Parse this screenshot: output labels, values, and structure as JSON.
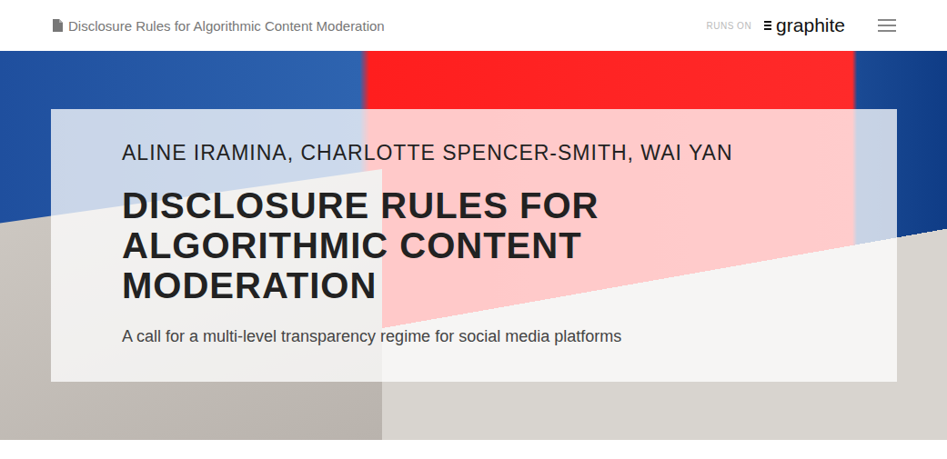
{
  "header": {
    "doc_title": "Disclosure Rules for Algorithmic Content Moderation",
    "runs_on": "RUNS ON",
    "logo": "graphite"
  },
  "hero": {
    "authors": "ALINE IRAMINA, CHARLOTTE SPENCER-SMITH, WAI YAN",
    "title": "DISCLOSURE RULES FOR ALGORITHMIC CONTENT MODERATION",
    "subtitle": "A call for a multi-level transparency regime for social media platforms"
  }
}
